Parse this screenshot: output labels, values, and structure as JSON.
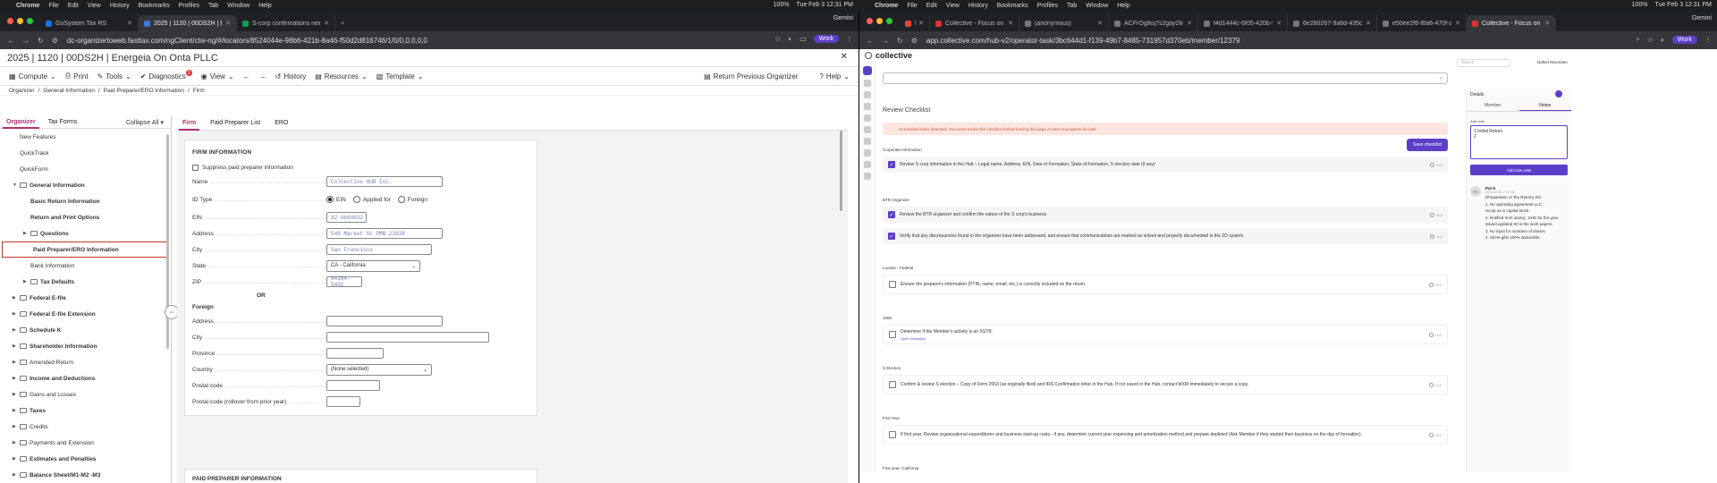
{
  "menubar_left": {
    "app": "Chrome",
    "items": [
      "File",
      "Edit",
      "View",
      "History",
      "Bookmarks",
      "Profiles",
      "Tab",
      "Window",
      "Help"
    ],
    "battery": "100%",
    "clock": "Tue Feb 3  12:31 PM"
  },
  "menubar_right": {
    "app": "Chrome",
    "items": [
      "File",
      "Edit",
      "View",
      "History",
      "Bookmarks",
      "Profiles",
      "Tab",
      "Window",
      "Help"
    ],
    "battery": "100%",
    "clock": "Tue Feb 3  12:31 PM"
  },
  "left_browser": {
    "tabs": [
      "GoSystem Tax RS",
      "2025 | 1120 | 00DS2H | Energ",
      "S-corp confirmations neede"
    ],
    "gemini": "Gemini",
    "url": "dc-organizertoweb.fasttax.com/ngClient/ctw-ng/#/locators/8524044e-98b6-421b-8a46-f50d2d816746/1/0/0,0,0,0,0",
    "work": "Work"
  },
  "fasttax": {
    "title": "2025 | 1120 | 00DS2H | Energeia On Onta PLLC",
    "toolbar": {
      "compute": "Compute",
      "print": "Print",
      "tools": "Tools",
      "diagnostics": "Diagnostics",
      "diag_count": "2",
      "view": "View",
      "history": "History",
      "resources": "Resources",
      "template": "Template",
      "return_prev": "Return Previous Organizer",
      "help": "Help"
    },
    "breadcrumb": [
      "Organizer",
      "General Information",
      "Paid Preparer/ERO Information",
      "Firm"
    ],
    "sidebar_tabs": [
      "Organizer",
      "Tax Forms"
    ],
    "collapse_all": "Collapse All",
    "tree": [
      {
        "label": "New Features",
        "indent": 0,
        "caret": false,
        "folder": false,
        "bold": false,
        "sel": false
      },
      {
        "label": "QuickTrack",
        "indent": 0,
        "caret": false,
        "folder": false,
        "bold": false,
        "sel": false
      },
      {
        "label": "QuickForm",
        "indent": 0,
        "caret": false,
        "folder": false,
        "bold": false,
        "sel": false
      },
      {
        "label": "General Information",
        "indent": 0,
        "caret": "▼",
        "folder": true,
        "bold": true,
        "sel": false
      },
      {
        "label": "Basic Return Information",
        "indent": 1,
        "caret": false,
        "folder": false,
        "bold": true,
        "sel": false
      },
      {
        "label": "Return and Print Options",
        "indent": 1,
        "caret": false,
        "folder": false,
        "bold": true,
        "sel": false
      },
      {
        "label": "Questions",
        "indent": 1,
        "caret": "▶",
        "folder": true,
        "bold": true,
        "sel": false
      },
      {
        "label": "Paid Preparer/ERO Information",
        "indent": 1,
        "caret": false,
        "folder": false,
        "bold": true,
        "sel": true
      },
      {
        "label": "Bank Information",
        "indent": 1,
        "caret": false,
        "folder": false,
        "bold": false,
        "sel": false
      },
      {
        "label": "Tax Defaults",
        "indent": 1,
        "caret": "▶",
        "folder": true,
        "bold": true,
        "sel": false
      },
      {
        "label": "Federal E-file",
        "indent": 0,
        "caret": "▶",
        "folder": true,
        "bold": true,
        "sel": false
      },
      {
        "label": "Federal E-file Extension",
        "indent": 0,
        "caret": "▶",
        "folder": true,
        "bold": true,
        "sel": false
      },
      {
        "label": "Schedule K",
        "indent": 0,
        "caret": "▶",
        "folder": true,
        "bold": true,
        "sel": false
      },
      {
        "label": "Shareholder Information",
        "indent": 0,
        "caret": "▶",
        "folder": true,
        "bold": true,
        "sel": false
      },
      {
        "label": "Amended Return",
        "indent": 0,
        "caret": "▶",
        "folder": true,
        "bold": false,
        "sel": false
      },
      {
        "label": "Income and Deductions",
        "indent": 0,
        "caret": "▶",
        "folder": true,
        "bold": true,
        "sel": false
      },
      {
        "label": "Gains and Losses",
        "indent": 0,
        "caret": "▶",
        "folder": true,
        "bold": false,
        "sel": false
      },
      {
        "label": "Taxes",
        "indent": 0,
        "caret": "▶",
        "folder": true,
        "bold": true,
        "sel": false
      },
      {
        "label": "Credits",
        "indent": 0,
        "caret": "▶",
        "folder": true,
        "bold": false,
        "sel": false
      },
      {
        "label": "Payments and Extension",
        "indent": 0,
        "caret": "▶",
        "folder": true,
        "bold": false,
        "sel": false
      },
      {
        "label": "Estimates and Penalties",
        "indent": 0,
        "caret": "▶",
        "folder": true,
        "bold": true,
        "sel": false
      },
      {
        "label": "Balance Sheet/M1-M2 -M3",
        "indent": 0,
        "caret": "▶",
        "folder": true,
        "bold": true,
        "sel": false
      }
    ],
    "subtabs": [
      "Firm",
      "Paid Preparer List",
      "ERO"
    ],
    "form": {
      "section": "FIRM INFORMATION",
      "suppress": "Suppress paid preparer information",
      "name_label": "Name",
      "name_value": "Collective HUB Inc.",
      "idtype_label": "ID Type",
      "id_opts": [
        "EIN",
        "Applied for",
        "Foreign"
      ],
      "ein_label": "EIN",
      "ein_value": "82-4664632",
      "address_label": "Address",
      "address_value": "548 Market St PMB 22838",
      "city_label": "City",
      "city_value": "San Francisco",
      "state_label": "State",
      "state_value": "CA - California",
      "zip_label": "ZIP",
      "zip_value": "94104-5401",
      "or": "OR",
      "foreign": "Foreign",
      "f_address": "Address",
      "f_city": "City",
      "f_province": "Province",
      "f_country": "Country",
      "f_country_value": "(None selected)",
      "f_postal": "Postal code",
      "f_postal_prior": "Postal code (rollover from prior year)",
      "section2": "PAID PREPARER INFORMATION"
    }
  },
  "right_browser": {
    "tabs": [
      "E-mail",
      "Collective - Focus on your",
      "(anonymous)",
      "ACFrOg8oj7s2gay2MZ...",
      "f4d1444c-6f05-420b-95...",
      "6e280267-9a6d-435c-8...",
      "e50ee2f6-8fa6-470f-ad9...",
      "Collective - Focus on your"
    ],
    "gemini": "Gemini",
    "url": "app.collective.com/hub-v2/operator-task/3bc644d1-f139-49b7-8485-731957d370eb/member/12379",
    "work": "Work"
  },
  "collective": {
    "brand": "collective",
    "review_title": "Review Checklist",
    "warning": "Unresolved tasks detected. You must resolve the checklist before leaving this page or save in progress for later.",
    "save_label": "Save checklist",
    "sections": [
      {
        "title": "Corporate Information",
        "items": [
          {
            "text": "Review S corp information in the Hub – Legal name, Address, EIN, Date of Formation, State of Formation, S election date (if any)",
            "checked": true,
            "sub": "",
            "na": "N/A"
          }
        ]
      },
      {
        "title": "BTR Organizer",
        "items": [
          {
            "text": "Review the BTR organizer and confirm the nature of the S corp's business",
            "checked": true,
            "sub": "",
            "na": "N/A"
          },
          {
            "text": "Verify that any discrepancies found in the organizer have been addressed, and ensure that communications are marked as solved and properly documented in the ZD system.",
            "checked": true,
            "sub": "",
            "na": "N/A"
          }
        ]
      },
      {
        "title": "Locator - Federal",
        "items": [
          {
            "text": "Ensure the preparer's information (PTIN, name, email, etc.) is correctly included on the return.",
            "checked": false,
            "sub": "",
            "na": "N/A"
          }
        ]
      },
      {
        "title": "1065",
        "items": [
          {
            "text": "Determine if the Member's activity is an SSTB.",
            "checked": false,
            "sub": "Open Wizard(s)",
            "na": "N/A"
          }
        ]
      },
      {
        "title": "S Election",
        "items": [
          {
            "text": "Confirm & review S election – Copy of Form 2553 (as originally filed) and IRS Confirmation letter in the Hub. If not saved in the Hub, contact MXM immediately to secure a copy.",
            "checked": false,
            "sub": "",
            "na": "N/A"
          }
        ]
      },
      {
        "title": "First Year",
        "items": [
          {
            "text": "If first year, Review organizational expenditures and business start-up costs - if any, determine current year expensing and amortization method and prepare depleted (Ask Member if they started their business on the day of formation).",
            "checked": false,
            "sub": "",
            "na": "N/A"
          }
        ]
      },
      {
        "title": "First year: California",
        "items": []
      }
    ],
    "side": {
      "search": "Search",
      "user": "Dalton Neumann",
      "details": "Details",
      "tabs": [
        "Member",
        "Notes"
      ],
      "add_note_label": "Add note",
      "note_text": "1 Initial Return\n2",
      "add_new": "Add new note",
      "note_author": "Pat K",
      "note_time": "2026-02-02 17:47:36",
      "note_body": "(Preparation of Tax Return) 2/3\n1. No operating agreement LLC.\nScorp as is capital stock.\n2. Notified SHC &amp;; SHD for the year. Saved updated 83 in the work papers.\n3. No input for numbers of shares.\n4. Client gifts 100% deductible."
    }
  }
}
